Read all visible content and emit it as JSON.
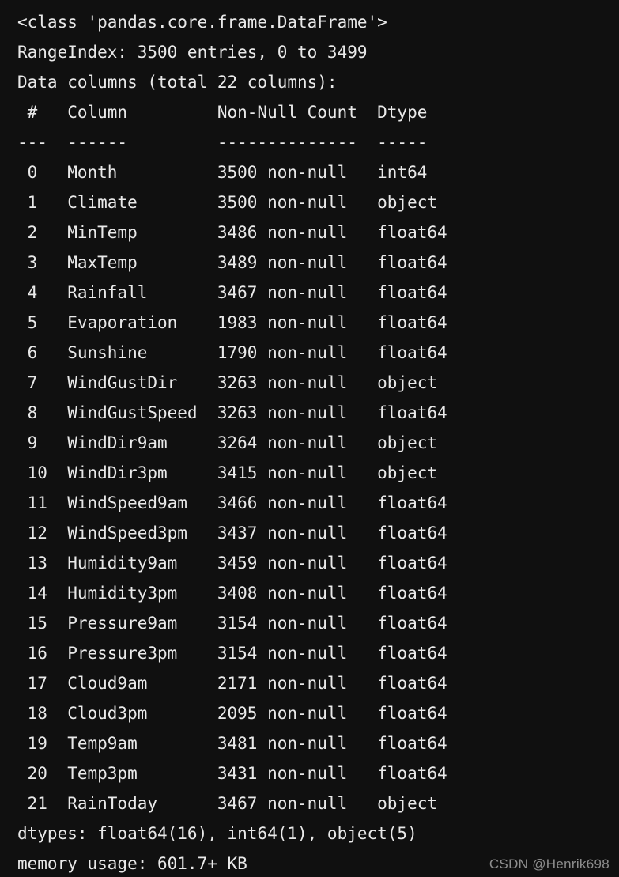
{
  "terminal": {
    "background_color": "#101010",
    "text_color": "#e9e9e9",
    "header_class_line": "<class 'pandas.core.frame.DataFrame'>",
    "range_index_line": "RangeIndex: 3500 entries, 0 to 3499",
    "data_columns_line": "Data columns (total 22 columns):",
    "table_header_line": " #   Column         Non-Null Count  Dtype  ",
    "table_rule_line": "---  ------         --------------  -----  ",
    "rows": [
      " 0   Month          3500 non-null   int64  ",
      " 1   Climate        3500 non-null   object ",
      " 2   MinTemp        3486 non-null   float64",
      " 3   MaxTemp        3489 non-null   float64",
      " 4   Rainfall       3467 non-null   float64",
      " 5   Evaporation    1983 non-null   float64",
      " 6   Sunshine       1790 non-null   float64",
      " 7   WindGustDir    3263 non-null   object ",
      " 8   WindGustSpeed  3263 non-null   float64",
      " 9   WindDir9am     3264 non-null   object ",
      " 10  WindDir3pm     3415 non-null   object ",
      " 11  WindSpeed9am   3466 non-null   float64",
      " 12  WindSpeed3pm   3437 non-null   float64",
      " 13  Humidity9am    3459 non-null   float64",
      " 14  Humidity3pm    3408 non-null   float64",
      " 15  Pressure9am    3154 non-null   float64",
      " 16  Pressure3pm    3154 non-null   float64",
      " 17  Cloud9am       2171 non-null   float64",
      " 18  Cloud3pm       2095 non-null   float64",
      " 19  Temp9am        3481 non-null   float64",
      " 20  Temp3pm        3431 non-null   float64",
      " 21  RainToday      3467 non-null   object "
    ],
    "dtypes_line": "dtypes: float64(16), int64(1), object(5)",
    "memory_usage_line": "memory usage: 601.7+ KB",
    "columns_detail": {
      "headers": [
        "#",
        "Column",
        "Non-Null Count",
        "Dtype"
      ],
      "entries": [
        {
          "index": "0",
          "column": "Month",
          "non_null": "3500 non-null",
          "dtype": "int64"
        },
        {
          "index": "1",
          "column": "Climate",
          "non_null": "3500 non-null",
          "dtype": "object"
        },
        {
          "index": "2",
          "column": "MinTemp",
          "non_null": "3486 non-null",
          "dtype": "float64"
        },
        {
          "index": "3",
          "column": "MaxTemp",
          "non_null": "3489 non-null",
          "dtype": "float64"
        },
        {
          "index": "4",
          "column": "Rainfall",
          "non_null": "3467 non-null",
          "dtype": "float64"
        },
        {
          "index": "5",
          "column": "Evaporation",
          "non_null": "1983 non-null",
          "dtype": "float64"
        },
        {
          "index": "6",
          "column": "Sunshine",
          "non_null": "1790 non-null",
          "dtype": "float64"
        },
        {
          "index": "7",
          "column": "WindGustDir",
          "non_null": "3263 non-null",
          "dtype": "object"
        },
        {
          "index": "8",
          "column": "WindGustSpeed",
          "non_null": "3263 non-null",
          "dtype": "float64"
        },
        {
          "index": "9",
          "column": "WindDir9am",
          "non_null": "3264 non-null",
          "dtype": "object"
        },
        {
          "index": "10",
          "column": "WindDir3pm",
          "non_null": "3415 non-null",
          "dtype": "object"
        },
        {
          "index": "11",
          "column": "WindSpeed9am",
          "non_null": "3466 non-null",
          "dtype": "float64"
        },
        {
          "index": "12",
          "column": "WindSpeed3pm",
          "non_null": "3437 non-null",
          "dtype": "float64"
        },
        {
          "index": "13",
          "column": "Humidity9am",
          "non_null": "3459 non-null",
          "dtype": "float64"
        },
        {
          "index": "14",
          "column": "Humidity3pm",
          "non_null": "3408 non-null",
          "dtype": "float64"
        },
        {
          "index": "15",
          "column": "Pressure9am",
          "non_null": "3154 non-null",
          "dtype": "float64"
        },
        {
          "index": "16",
          "column": "Pressure3pm",
          "non_null": "3154 non-null",
          "dtype": "float64"
        },
        {
          "index": "17",
          "column": "Cloud9am",
          "non_null": "2171 non-null",
          "dtype": "float64"
        },
        {
          "index": "18",
          "column": "Cloud3pm",
          "non_null": "2095 non-null",
          "dtype": "float64"
        },
        {
          "index": "19",
          "column": "Temp9am",
          "non_null": "3481 non-null",
          "dtype": "float64"
        },
        {
          "index": "20",
          "column": "Temp3pm",
          "non_null": "3431 non-null",
          "dtype": "float64"
        },
        {
          "index": "21",
          "column": "RainToday",
          "non_null": "3467 non-null",
          "dtype": "object"
        }
      ]
    }
  },
  "watermark": {
    "text": "CSDN @Henrik698",
    "color": "#8d8d8d"
  }
}
